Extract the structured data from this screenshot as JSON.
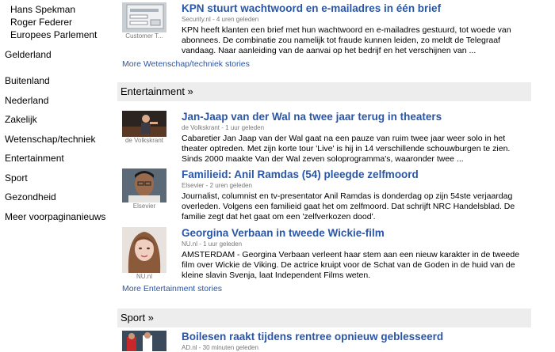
{
  "sidebar": {
    "sub_items": [
      "Hans Spekman",
      "Roger Federer",
      "Europees Parlement"
    ],
    "items": [
      "Gelderland",
      "Buitenland",
      "Nederland",
      "Zakelijk",
      "Wetenschap/techniek",
      "Entertainment",
      "Sport",
      "Gezondheid",
      "Meer voorpaginanieuws"
    ]
  },
  "wetenschap": {
    "story": {
      "thumb_caption": "Customer T...",
      "title": "KPN stuurt wachtwoord en e-mailadres in één brief",
      "source": "Security.nl",
      "time": " - 4 uren geleden",
      "snippet": "KPN heeft klanten een brief met hun wachtwoord en e-mailadres gestuurd, tot woede van abonnees. De combinatie zou namelijk tot fraude kunnen leiden, zo meldt de Telegraaf vandaag. Naar aanleiding van de aanvai op het bedrijf en het verschijnen van ..."
    },
    "more": "More Wetenschap/techniek stories"
  },
  "entertainment": {
    "header": "Entertainment »",
    "stories": [
      {
        "thumb_caption": "de Volkskrant",
        "title": "Jan-Jaap van der Wal na twee jaar terug in theaters",
        "source": "de Volkskrant",
        "time": " - 1 uur geleden",
        "snippet": "Cabaretier Jan Jaap van der Wal gaat na een pauze van ruim twee jaar weer solo in het theater optreden. Met zijn korte tour 'Live' is hij in 14 verschillende schouwburgen te zien. Sinds 2000 maakte Van der Wal zeven soloprogramma's, waaronder twee ..."
      },
      {
        "thumb_caption": "Elsevier",
        "title": "Familieid: Anil Ramdas (54) pleegde zelfmoord",
        "source": "Elsevier",
        "time": " - 2 uren geleden",
        "snippet": "Journalist, columnist en tv-presentator Anil Ramdas is donderdag op zijn 54ste verjaardag overleden. Volgens een familieid gaat het om zelfmoord. Dat schrijft NRC Handelsblad. De familie zegt dat het gaat om een 'zelfverkozen dood'."
      },
      {
        "thumb_caption": "NU.nl",
        "title": "Georgina Verbaan in tweede Wickie-film",
        "source": "NU.nl",
        "time": " - 1 uur geleden",
        "snippet": "AMSTERDAM - Georgina Verbaan verleent haar stem aan een nieuw karakter in de tweede film over Wickie de Viking. De actrice kruipt voor de Schat van de Goden in de huid van de kleine slavin Svenja, laat Independent Films weten."
      }
    ],
    "more": "More Entertainment stories"
  },
  "sport": {
    "header": "Sport »",
    "story": {
      "title": "Boilesen raakt tijdens rentree opnieuw geblesseerd",
      "source": "AD.nl",
      "time": " - 30 minuten geleden"
    }
  }
}
